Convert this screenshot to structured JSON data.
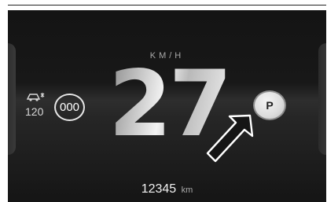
{
  "display": {
    "speed_unit": "KM/H",
    "speed": "27",
    "speed_limit_setting": "120",
    "speed_limit_sign": "000",
    "park_indicator": "P",
    "odometer": "12345",
    "odometer_unit": "km"
  },
  "icons": {
    "limit_assist": "speed-limit-assist-icon",
    "arrow": "callout-arrow-icon"
  },
  "colors": {
    "background": "#151515",
    "text": "#f2f2f2",
    "secondary_text": "#a9a9a9",
    "park_button": "#dcdcdc"
  }
}
